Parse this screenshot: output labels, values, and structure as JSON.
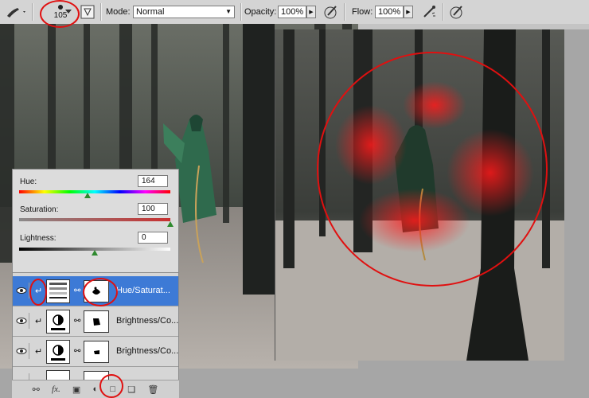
{
  "options_bar": {
    "brush_size": "105",
    "mode_label": "Mode:",
    "mode_value": "Normal",
    "opacity_label": "Opacity:",
    "opacity_value": "100%",
    "flow_label": "Flow:",
    "flow_value": "100%"
  },
  "hue_saturation": {
    "hue_label": "Hue:",
    "hue_value": "164",
    "saturation_label": "Saturation:",
    "saturation_value": "100",
    "lightness_label": "Lightness:",
    "lightness_value": "0",
    "hue_slider_fraction": 0.455,
    "saturation_slider_fraction": 1.0,
    "lightness_slider_fraction": 0.5
  },
  "layers": [
    {
      "name": "Hue/Saturat...",
      "selected": true,
      "type": "hue-saturation"
    },
    {
      "name": "Brightness/Co...",
      "selected": false,
      "type": "brightness-contrast"
    },
    {
      "name": "Brightness/Co...",
      "selected": false,
      "type": "brightness-contrast"
    }
  ],
  "colors": {
    "annotation_red": "#e01010",
    "selected_layer": "#3d7ad6",
    "cloak_green": "#2f6a4d",
    "glow_red": "#ff1a1a"
  }
}
